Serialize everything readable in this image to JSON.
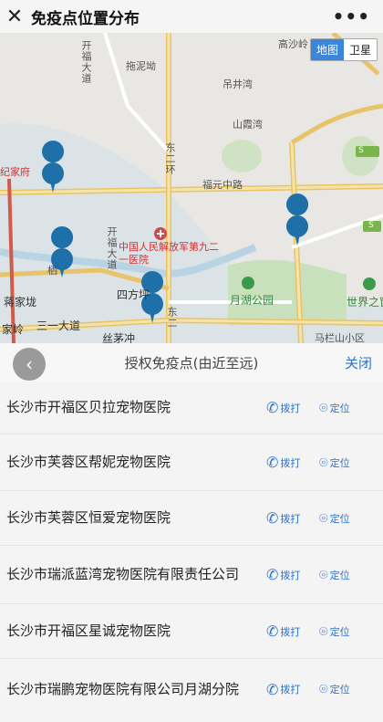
{
  "header": {
    "close_icon": "close-icon",
    "title": "免疫点位置分布",
    "more_icon": "more-icon"
  },
  "map": {
    "toggle": {
      "map_label": "地图",
      "satellite_label": "卫星"
    },
    "labels": {
      "gaoshaling": "高沙岭",
      "tuoliyao": "拖泥坳",
      "kaifudadao": "开福大道",
      "yuejing": "吊井湾",
      "shanyuwan": "山霞湾",
      "dongerhuan": "东二环",
      "fuyuanzhonglu": "福元中路",
      "jisuowan": "纪家府",
      "people_hospital": "中国人民解放军第九二一医院",
      "kaifu_ave_v": "开福大道",
      "yuehu_park": "月湖公园",
      "shijiezhichuang": "世界之窗",
      "sifangping": "四方坪",
      "jiangjialong": "蒋家垅",
      "sanyidadao": "三一大道",
      "jialing": "家岭",
      "sichong": "丝茅冲",
      "mayiqu": "马栏山小区",
      "east2": "东二",
      "piao": "栖"
    },
    "route_badges": [
      "S",
      "S"
    ]
  },
  "sheet": {
    "back_icon": "chevron-left-icon",
    "title": "授权免疫点(由近至远)",
    "close_label": "关闭",
    "items": [
      {
        "name": "长沙市开福区贝拉宠物医院",
        "call": "拨打",
        "locate": "定位"
      },
      {
        "name": "长沙市芙蓉区帮妮宠物医院",
        "call": "拨打",
        "locate": "定位"
      },
      {
        "name": "长沙市芙蓉区恒爱宠物医院",
        "call": "拨打",
        "locate": "定位"
      },
      {
        "name": "长沙市瑞派蓝湾宠物医院有限责任公司",
        "call": "拨打",
        "locate": "定位"
      },
      {
        "name": "长沙市开福区星诚宠物医院",
        "call": "拨打",
        "locate": "定位"
      },
      {
        "name": "长沙市瑞鹏宠物医院有限公司月湖分院",
        "call": "拨打",
        "locate": "定位"
      }
    ]
  },
  "colors": {
    "accent": "#2e73c7",
    "map_toggle_active": "#3b86d9",
    "marker": "#1f6fa8"
  }
}
